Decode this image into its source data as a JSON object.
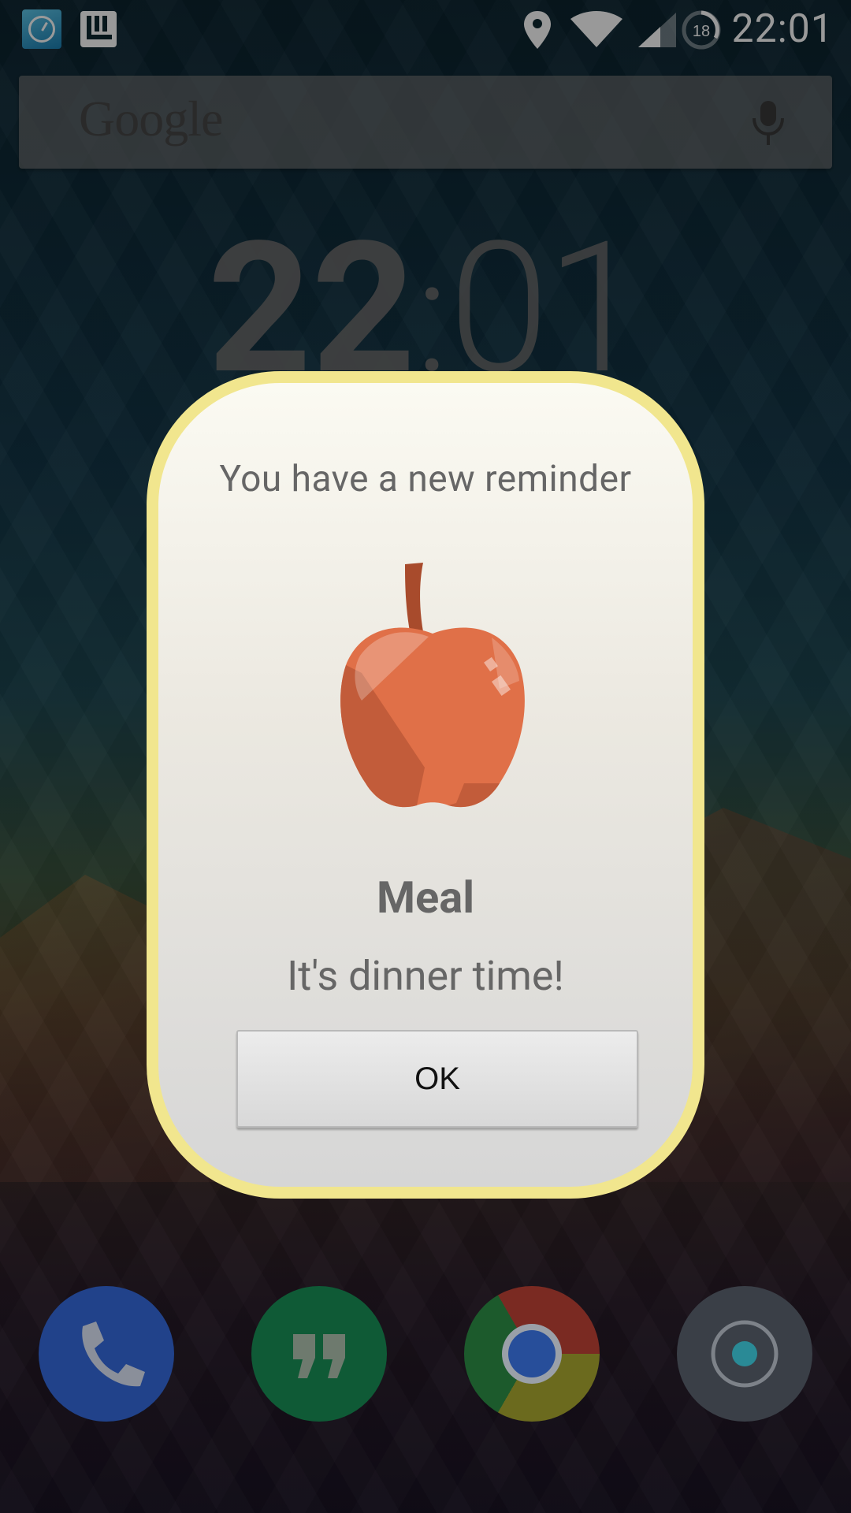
{
  "status_bar": {
    "time": "22:01",
    "notification_badge": "18",
    "reminders_icon_label": "reminders"
  },
  "search": {
    "logo": "Google"
  },
  "lockscreen_clock": {
    "hours": "22",
    "separator": ":",
    "minutes": "01"
  },
  "dialog": {
    "title": "You have a new reminder",
    "icon": "apple-icon",
    "reminder_name": "Meal",
    "reminder_message": "It's dinner time!",
    "ok_label": "OK"
  },
  "dock": {
    "apps": [
      "phone",
      "hangouts",
      "chrome",
      "camera"
    ]
  },
  "colors": {
    "dialog_border": "#f1e68e",
    "apple": "#e07048",
    "phone": "#21428a",
    "hangouts": "#0f5a36"
  }
}
